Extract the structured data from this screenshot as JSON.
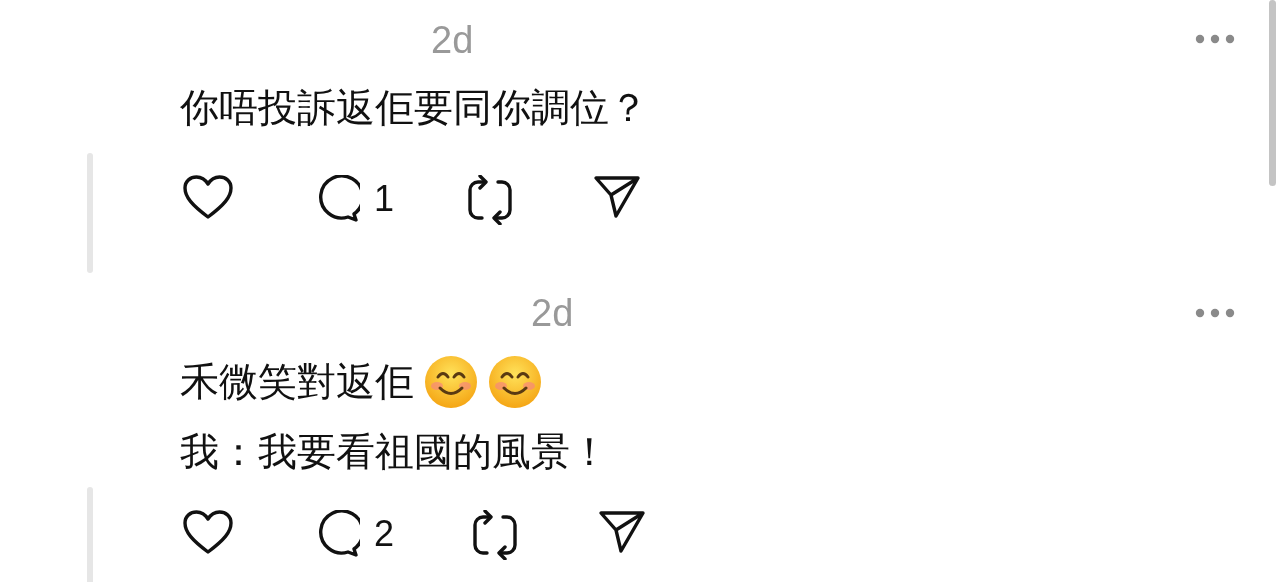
{
  "posts": [
    {
      "time": "2d",
      "lines": [
        {
          "text": "你唔投訴返佢要同你調位？"
        }
      ],
      "liked": false,
      "reply_count": "1"
    },
    {
      "time": "2d",
      "lines": [
        {
          "text": "禾微笑對返佢",
          "emojis": [
            {
              "kind": "smiling-face"
            },
            {
              "kind": "smiling-face"
            }
          ]
        },
        {
          "text": "我：我要看祖國的風景！"
        }
      ],
      "liked": false,
      "reply_count": "2"
    }
  ]
}
